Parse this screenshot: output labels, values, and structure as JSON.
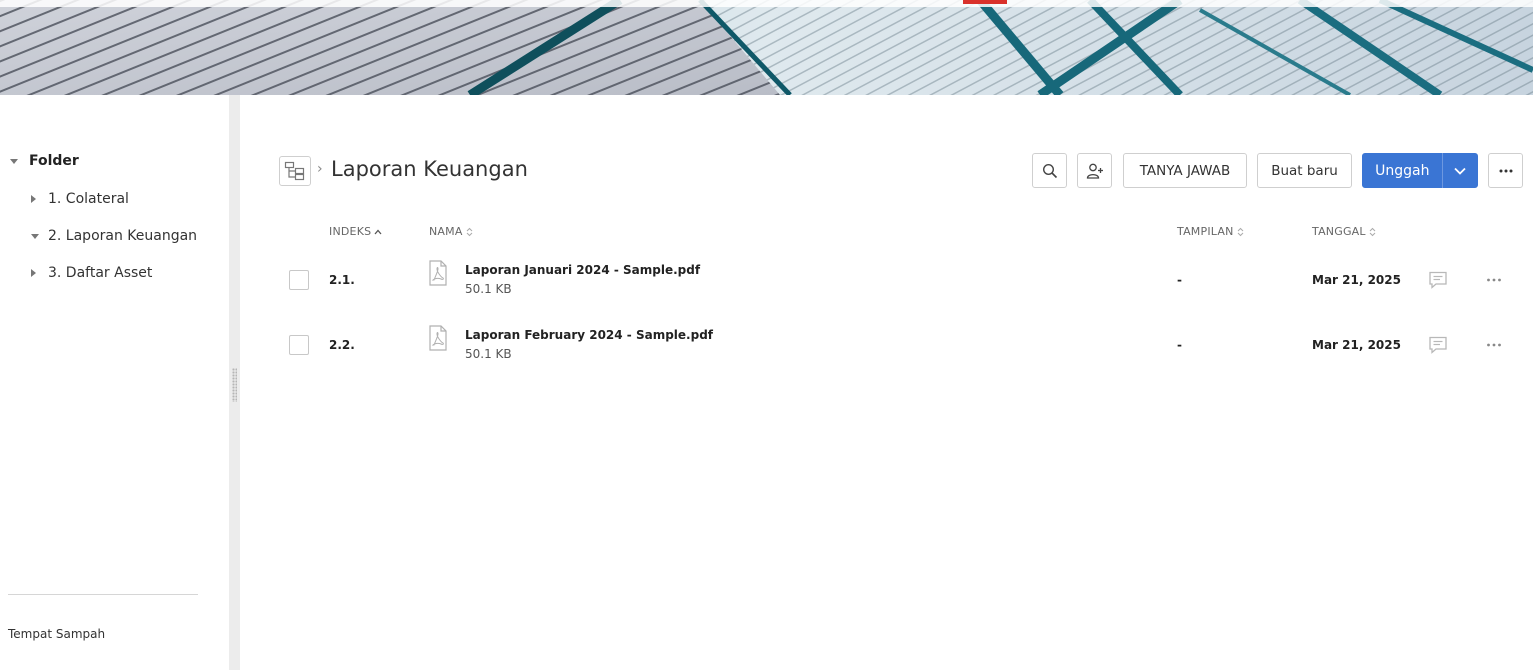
{
  "sidebar": {
    "root_label": "Folder",
    "items": [
      {
        "label": "1. Colateral",
        "expanded": false
      },
      {
        "label": "2. Laporan Keuangan",
        "expanded": true
      },
      {
        "label": "3. Daftar Asset",
        "expanded": false
      }
    ],
    "trash_label": "Tempat Sampah"
  },
  "header": {
    "title": "Laporan Keuangan",
    "breadcrumb_separator": "›",
    "buttons": {
      "qa_label": "TANYA JAWAB",
      "new_label": "Buat baru",
      "upload_label": "Unggah"
    }
  },
  "table": {
    "columns": {
      "index": "INDEKS",
      "name": "NAMA",
      "views": "TAMPILAN",
      "date": "TANGGAL"
    },
    "rows": [
      {
        "index": "2.1.",
        "name": "Laporan Januari 2024 - Sample.pdf",
        "size": "50.1 KB",
        "views": "-",
        "date": "Mar 21, 2025"
      },
      {
        "index": "2.2.",
        "name": "Laporan February 2024 - Sample.pdf",
        "size": "50.1 KB",
        "views": "-",
        "date": "Mar 21, 2025"
      }
    ]
  },
  "colors": {
    "accent": "#3a75d4",
    "top_accent": "#d9312b",
    "splitter": "#ececec"
  },
  "icons": [
    "folder-tree-icon",
    "search-icon",
    "add-user-icon",
    "chevron-down-icon",
    "more-icon",
    "pdf-file-icon",
    "comment-icon",
    "sort-icon"
  ]
}
